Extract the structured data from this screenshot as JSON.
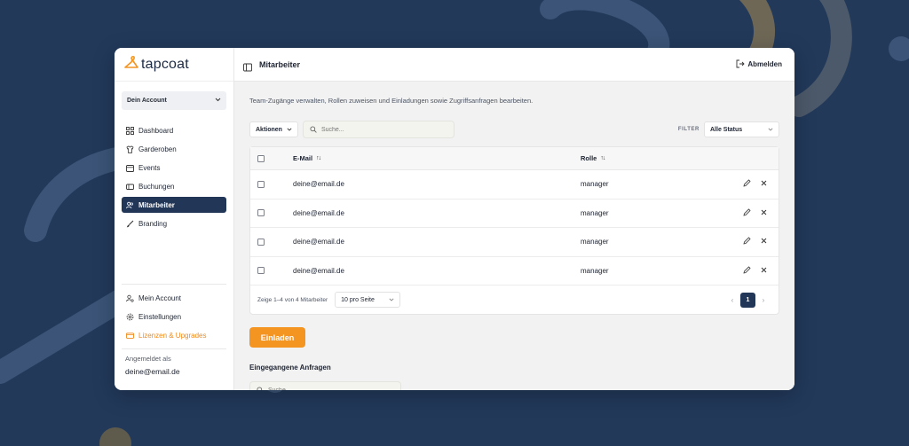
{
  "colors": {
    "background": "#22395a",
    "accent": "#f49421",
    "active_nav": "#223658"
  },
  "brand": {
    "name": "tapcoat",
    "icon": "hanger-icon"
  },
  "account_select": {
    "value": "Dein Account"
  },
  "nav": {
    "items": [
      {
        "label": "Dashboard",
        "icon": "dashboard-icon"
      },
      {
        "label": "Garderoben",
        "icon": "shirt-icon"
      },
      {
        "label": "Events",
        "icon": "calendar-icon"
      },
      {
        "label": "Buchungen",
        "icon": "ticket-icon"
      },
      {
        "label": "Mitarbeiter",
        "icon": "users-icon"
      },
      {
        "label": "Branding",
        "icon": "brush-icon"
      }
    ],
    "bottom_items": [
      {
        "label": "Mein Account",
        "icon": "user-settings-icon"
      },
      {
        "label": "Einstellungen",
        "icon": "gear-icon"
      },
      {
        "label": "Lizenzen & Upgrades",
        "icon": "card-icon"
      }
    ]
  },
  "session": {
    "label": "Angemeldet als",
    "email": "deine@email.de"
  },
  "header": {
    "title": "Mitarbeiter",
    "logout_label": "Abmelden"
  },
  "page": {
    "description": "Team-Zugänge verwalten, Rollen zuweisen und Einladungen sowie Zugriffsanfragen bearbeiten.",
    "actions_label": "Aktionen",
    "search_placeholder": "Suche...",
    "filter_label": "FILTER",
    "filter_value": "Alle Status"
  },
  "table": {
    "columns": [
      "E-Mail",
      "Rolle"
    ],
    "rows": [
      {
        "email": "deine@email.de",
        "role": "manager"
      },
      {
        "email": "deine@email.de",
        "role": "manager"
      },
      {
        "email": "deine@email.de",
        "role": "manager"
      },
      {
        "email": "deine@email.de",
        "role": "manager"
      }
    ],
    "footer_info": "Zeige 1–4 von 4 Mitarbeiter",
    "per_page": "10 pro Seite",
    "current_page": "1",
    "prev": "‹",
    "next": "›"
  },
  "invite_label": "Einladen",
  "requests": {
    "title": "Eingegangene Anfragen",
    "search_placeholder": "Suche..."
  }
}
